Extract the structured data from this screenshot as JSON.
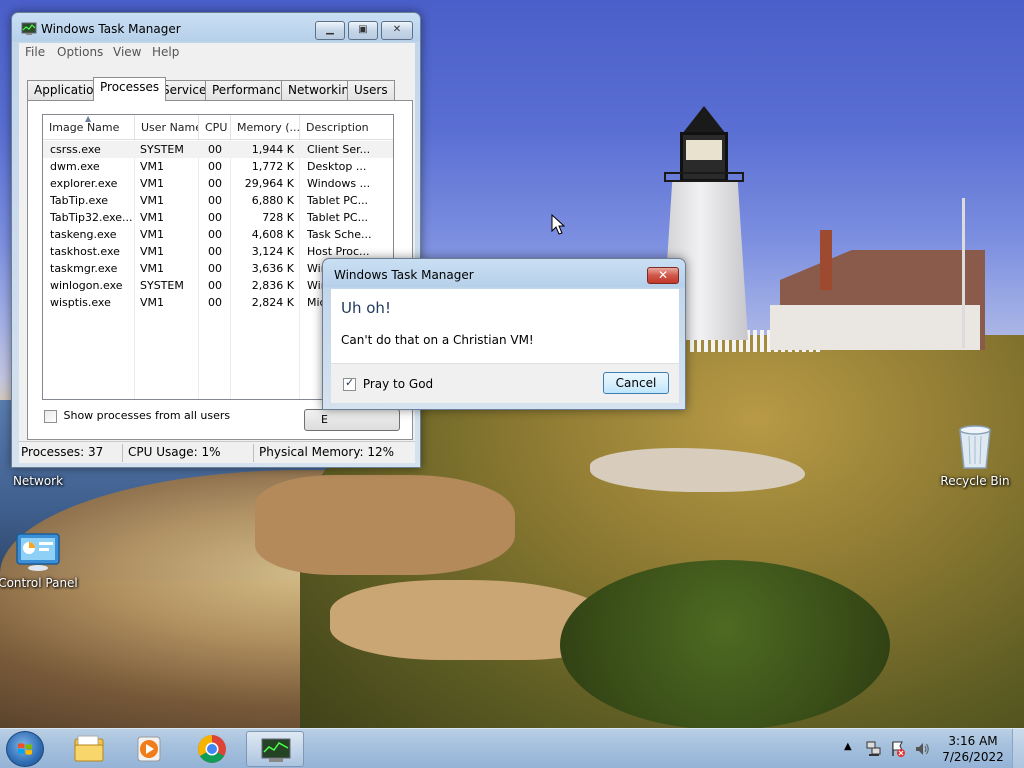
{
  "desktop": {
    "icons": {
      "network": "Network",
      "control_panel": "Control Panel",
      "recycle_bin": "Recycle Bin"
    }
  },
  "taskmgr": {
    "title": "Windows Task Manager",
    "menu": [
      "File",
      "Options",
      "View",
      "Help"
    ],
    "tabs": [
      "Applications",
      "Processes",
      "Services",
      "Performance",
      "Networking",
      "Users"
    ],
    "active_tab": "Processes",
    "columns": [
      "Image Name",
      "User Name",
      "CPU",
      "Memory (...",
      "Description"
    ],
    "rows": [
      {
        "image": "csrss.exe",
        "user": "SYSTEM",
        "cpu": "00",
        "mem": "1,944 K",
        "desc": "Client Ser..."
      },
      {
        "image": "dwm.exe",
        "user": "VM1",
        "cpu": "00",
        "mem": "1,772 K",
        "desc": "Desktop ..."
      },
      {
        "image": "explorer.exe",
        "user": "VM1",
        "cpu": "00",
        "mem": "29,964 K",
        "desc": "Windows ..."
      },
      {
        "image": "TabTip.exe",
        "user": "VM1",
        "cpu": "00",
        "mem": "6,880 K",
        "desc": "Tablet PC..."
      },
      {
        "image": "TabTip32.exe...",
        "user": "VM1",
        "cpu": "00",
        "mem": "728 K",
        "desc": "Tablet PC..."
      },
      {
        "image": "taskeng.exe",
        "user": "VM1",
        "cpu": "00",
        "mem": "4,608 K",
        "desc": "Task Sche..."
      },
      {
        "image": "taskhost.exe",
        "user": "VM1",
        "cpu": "00",
        "mem": "3,124 K",
        "desc": "Host Proc..."
      },
      {
        "image": "taskmgr.exe",
        "user": "VM1",
        "cpu": "00",
        "mem": "3,636 K",
        "desc": "Windo"
      },
      {
        "image": "winlogon.exe",
        "user": "SYSTEM",
        "cpu": "00",
        "mem": "2,836 K",
        "desc": "Win"
      },
      {
        "image": "wisptis.exe",
        "user": "VM1",
        "cpu": "00",
        "mem": "2,824 K",
        "desc": "Mic"
      }
    ],
    "show_all_label": "Show processes from all users",
    "end_button_label": "E",
    "status": {
      "processes": "Processes: 37",
      "cpu": "CPU Usage: 1%",
      "memory": "Physical Memory: 12%"
    }
  },
  "dialog": {
    "title": "Windows Task Manager",
    "heading": "Uh oh!",
    "message": "Can't do that on a Christian VM!",
    "checkbox_label": "Pray to God",
    "checkbox_checked": true,
    "cancel_label": "Cancel"
  },
  "taskbar": {
    "pinned": [
      "explorer-icon",
      "media-player-icon",
      "chrome-icon",
      "task-manager-icon"
    ],
    "clock_time": "3:16 AM",
    "clock_date": "7/26/2022"
  },
  "colors": {
    "dialog_heading": "#1e395b",
    "close_red": "#c2382a",
    "taskbar": "#a5c0dd"
  }
}
